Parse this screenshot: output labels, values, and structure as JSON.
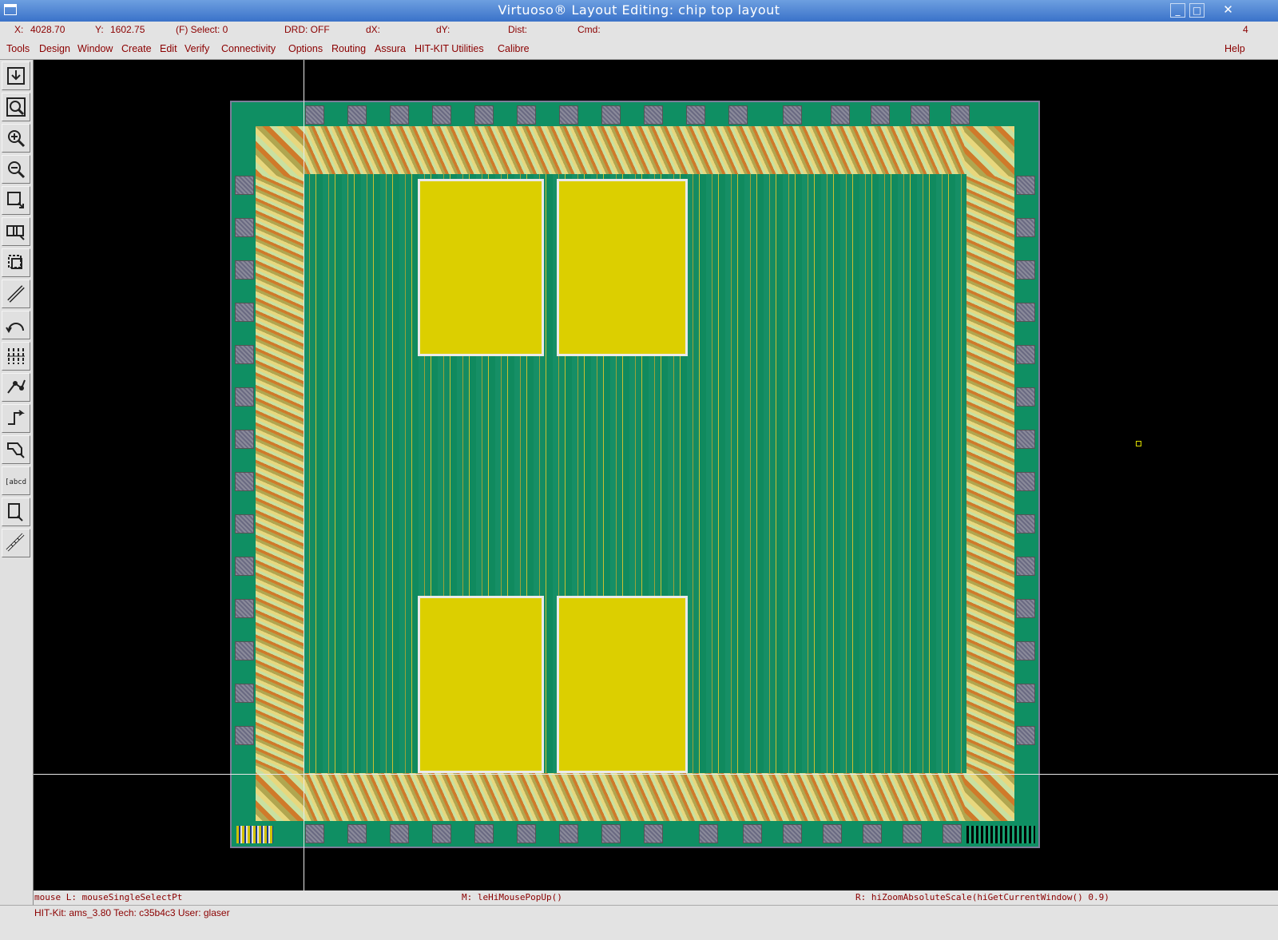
{
  "window": {
    "title": "Virtuoso® Layout Editing: chip top layout"
  },
  "status": {
    "x_label": "X:",
    "x_value": "4028.70",
    "y_label": "Y:",
    "y_value": "1602.75",
    "select": "(F) Select: 0",
    "drd": "DRD: OFF",
    "dx": "dX:",
    "dy": "dY:",
    "dist": "Dist:",
    "cmd": "Cmd:",
    "number": "4"
  },
  "menu": {
    "items": [
      "Tools",
      "Design",
      "Window",
      "Create",
      "Edit",
      "Verify",
      "Connectivity",
      "Options",
      "Routing",
      "Assura",
      "HIT-KIT Utilities",
      "Calibre"
    ],
    "help": "Help"
  },
  "toolbar": {
    "icons": [
      "save-icon",
      "fit-view-icon",
      "zoom-in-icon",
      "zoom-out-icon",
      "stretch-icon",
      "copy-icon",
      "move-icon",
      "path-icon",
      "undo-icon",
      "repeat-icon",
      "properties-icon",
      "wire-icon",
      "polygon-icon",
      "label-icon",
      "instance-icon",
      "ruler-icon"
    ],
    "label_tool": "[abcd]"
  },
  "mouse": {
    "left": "mouse L: mouseSingleSelectPt",
    "middle": "M: leHiMousePopUp()",
    "right": "R: hiZoomAbsoluteScale(hiGetCurrentWindow() 0.9)"
  },
  "info": {
    "text": "HIT-Kit: ams_3.80   Tech: c35b4c3   User: glaser"
  },
  "colors": {
    "substrate": "#0f8f63",
    "macro": "#dccf00",
    "accent_text": "#8b0000"
  }
}
